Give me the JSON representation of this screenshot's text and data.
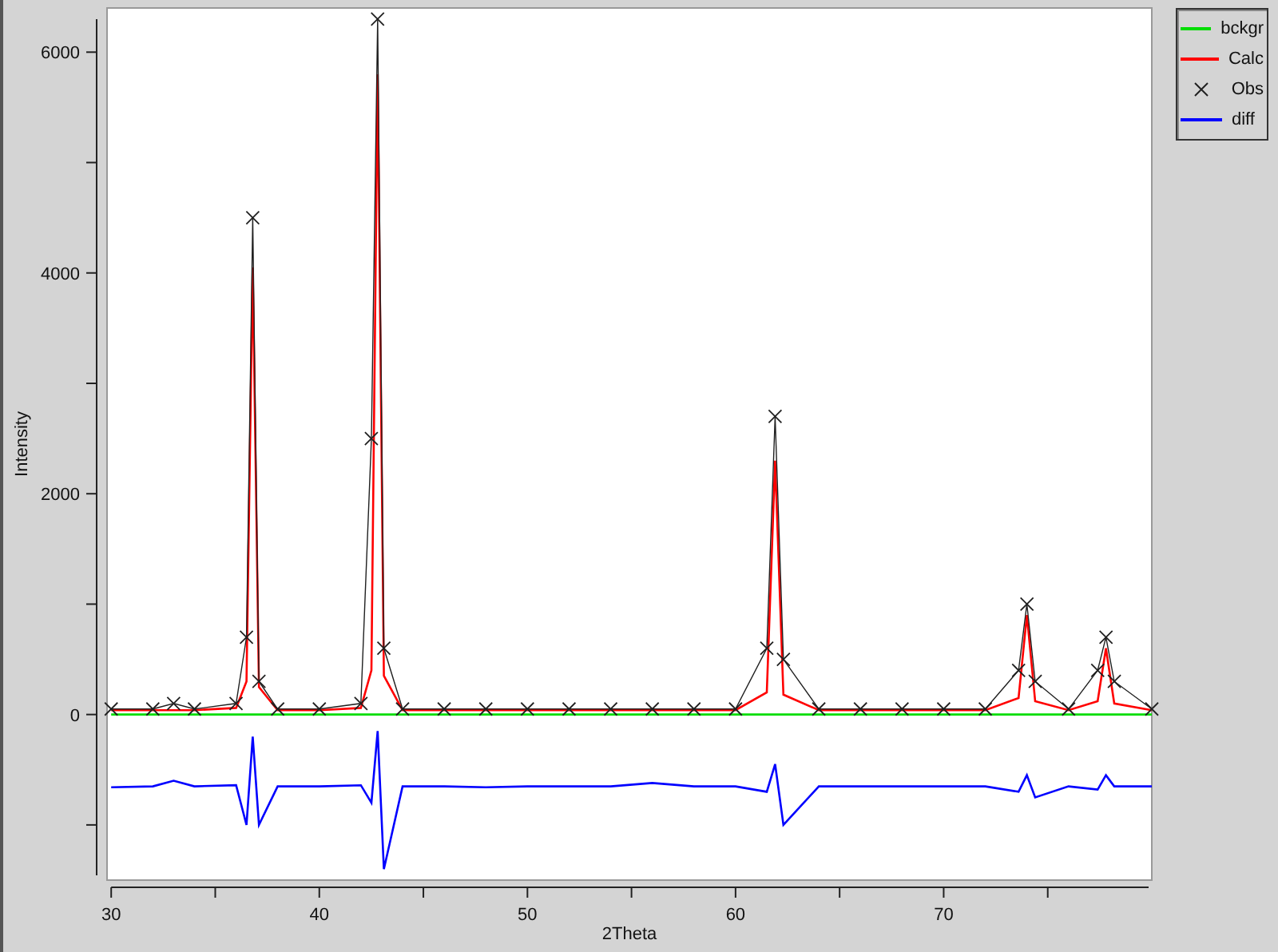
{
  "chart_data": {
    "type": "line",
    "xlabel": "2Theta",
    "ylabel": "Intensity",
    "xlim": [
      29.8,
      80
    ],
    "ylim": [
      -1500,
      6400
    ],
    "xticks": [
      30,
      40,
      50,
      60,
      70
    ],
    "yticks": [
      0,
      2000,
      4000,
      6000
    ],
    "x": [
      30,
      32,
      33,
      34,
      36,
      36.5,
      36.8,
      37.1,
      38,
      40,
      42,
      42.5,
      42.8,
      43.1,
      44,
      46,
      48,
      50,
      52,
      54,
      56,
      58,
      60,
      61.5,
      61.9,
      62.3,
      64,
      66,
      68,
      70,
      72,
      73.6,
      74.0,
      74.4,
      76,
      77.4,
      77.8,
      78.2,
      80
    ],
    "series": [
      {
        "name": "bckgr",
        "color": "#00dd00",
        "values": [
          0,
          0,
          0,
          0,
          0,
          0,
          0,
          0,
          0,
          0,
          0,
          0,
          0,
          0,
          0,
          0,
          0,
          0,
          0,
          0,
          0,
          0,
          0,
          0,
          0,
          0,
          0,
          0,
          0,
          0,
          0,
          0,
          0,
          0,
          0,
          0,
          0,
          0,
          0
        ]
      },
      {
        "name": "Calc",
        "color": "#ff0000",
        "values": [
          40,
          40,
          40,
          40,
          60,
          300,
          4050,
          250,
          40,
          40,
          60,
          400,
          5800,
          350,
          40,
          40,
          40,
          40,
          40,
          40,
          40,
          40,
          40,
          200,
          2300,
          180,
          40,
          40,
          40,
          40,
          40,
          150,
          900,
          120,
          40,
          120,
          600,
          100,
          40
        ]
      },
      {
        "name": "Obs",
        "color": "#202020",
        "marker": "x",
        "values": [
          50,
          50,
          100,
          50,
          100,
          700,
          4500,
          300,
          50,
          50,
          100,
          2500,
          6300,
          600,
          50,
          50,
          50,
          50,
          50,
          50,
          50,
          50,
          50,
          600,
          2700,
          500,
          50,
          50,
          50,
          50,
          50,
          400,
          1000,
          300,
          50,
          400,
          700,
          300,
          50
        ]
      },
      {
        "name": "diff",
        "color": "#0000ff",
        "values": [
          -660,
          -650,
          -600,
          -650,
          -640,
          -1000,
          -200,
          -1000,
          -650,
          -650,
          -640,
          -800,
          -150,
          -1400,
          -650,
          -650,
          -660,
          -650,
          -650,
          -650,
          -620,
          -650,
          -650,
          -700,
          -450,
          -1000,
          -650,
          -650,
          -650,
          -650,
          -650,
          -700,
          -550,
          -750,
          -650,
          -680,
          -550,
          -650,
          -650
        ]
      }
    ]
  }
}
